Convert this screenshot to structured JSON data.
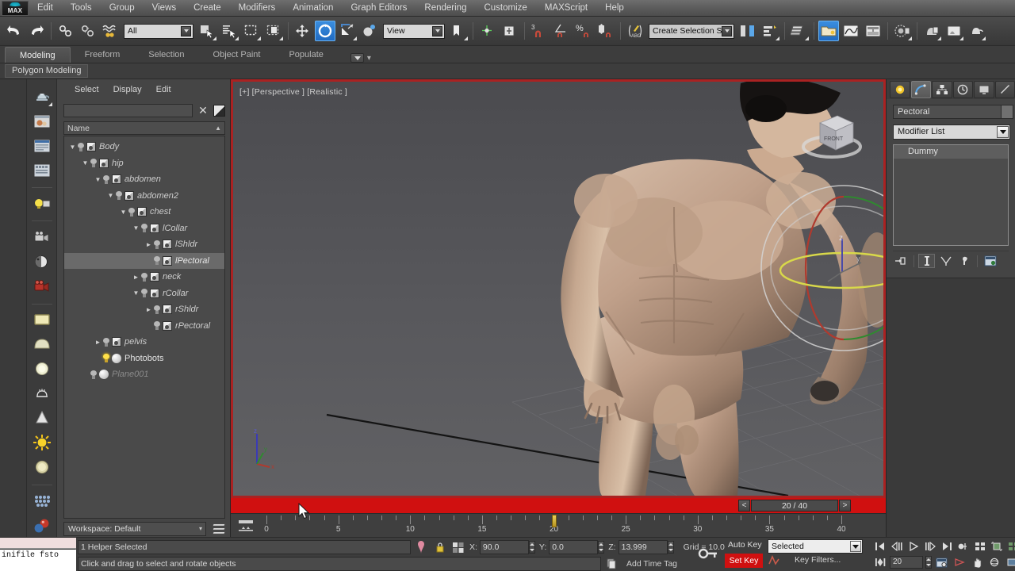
{
  "app": {
    "logo": "MAX",
    "menu": [
      "Edit",
      "Tools",
      "Group",
      "Views",
      "Create",
      "Modifiers",
      "Animation",
      "Graph Editors",
      "Rendering",
      "Customize",
      "MAXScript",
      "Help"
    ]
  },
  "toolbar": {
    "selection_filter": "All",
    "reference_coord": "View",
    "named_selection_set": "Create Selection Se",
    "snaps_percent": "%",
    "angle_snap_num": "3",
    "icons": [
      "undo-icon",
      "redo-icon",
      "select-and-link-icon",
      "unlink-selection-icon",
      "bind-to-space-warp-icon",
      "select-object-icon",
      "select-by-name-icon",
      "rectangular-selection-region-icon",
      "window-crossing-icon",
      "select-and-move-icon",
      "select-and-rotate-icon",
      "select-and-scale-icon",
      "select-and-place-icon",
      "use-pivot-point-center-icon",
      "select-and-manipulate-icon",
      "snaps-toggle-icon",
      "angle-snap-toggle-icon",
      "percent-snap-toggle-icon",
      "spinner-snap-toggle-icon",
      "edit-named-selection-sets-icon",
      "mirror-icon",
      "align-icon",
      "layer-explorer-icon",
      "scene-explorer-icon",
      "curve-editor-icon",
      "schematic-view-icon",
      "material-editor-icon",
      "render-setup-icon",
      "rendered-frame-window-icon",
      "render-production-icon"
    ]
  },
  "ribbon": {
    "tabs": [
      "Modeling",
      "Freeform",
      "Selection",
      "Object Paint",
      "Populate"
    ],
    "selected_tab": "Modeling",
    "panel_label": "Polygon Modeling"
  },
  "left_toolbox": {
    "icons": [
      "teapot-object-icon",
      "material-map-browser-icon",
      "render-frame-icon",
      "render-setup-panel-icon",
      "light-icon",
      "camera-icon",
      "shading-icon",
      "camera-red-icon",
      "box-icon",
      "sphere-icon",
      "circle-light-icon",
      "teapot-outline-icon",
      "cone-icon",
      "sun-light-icon",
      "disc-icon",
      "array-icon",
      "material-spheres-icon"
    ]
  },
  "explorer": {
    "menu": [
      "Select",
      "Display",
      "Edit"
    ],
    "search_value": "",
    "search_placeholder": "",
    "close_icon": "x-icon",
    "filter_icon": "filter-icon",
    "column_header": "Name",
    "sort_indicator": "▲",
    "tree": [
      {
        "label": "Body",
        "depth": 0,
        "twisty": "down",
        "icon": "cube",
        "state": "italic"
      },
      {
        "label": "hip",
        "depth": 1,
        "twisty": "down",
        "icon": "cube",
        "state": "italic"
      },
      {
        "label": "abdomen",
        "depth": 2,
        "twisty": "down",
        "icon": "cube",
        "state": "italic"
      },
      {
        "label": "abdomen2",
        "depth": 3,
        "twisty": "down",
        "icon": "cube",
        "state": "italic"
      },
      {
        "label": "chest",
        "depth": 4,
        "twisty": "down",
        "icon": "cube",
        "state": "italic"
      },
      {
        "label": "lCollar",
        "depth": 5,
        "twisty": "down",
        "icon": "cube",
        "state": "italic"
      },
      {
        "label": "lShldr",
        "depth": 6,
        "twisty": "right",
        "icon": "cube",
        "state": "italic"
      },
      {
        "label": "lPectoral",
        "depth": 6,
        "twisty": "none",
        "icon": "cube",
        "state": "selected"
      },
      {
        "label": "neck",
        "depth": 5,
        "twisty": "right",
        "icon": "cube",
        "state": "italic"
      },
      {
        "label": "rCollar",
        "depth": 5,
        "twisty": "down",
        "icon": "cube",
        "state": "italic"
      },
      {
        "label": "rShldr",
        "depth": 6,
        "twisty": "right",
        "icon": "cube",
        "state": "italic"
      },
      {
        "label": "rPectoral",
        "depth": 6,
        "twisty": "none",
        "icon": "cube",
        "state": "italic"
      },
      {
        "label": "pelvis",
        "depth": 2,
        "twisty": "right",
        "icon": "cube",
        "state": "italic"
      },
      {
        "label": "Photobots",
        "depth": 2,
        "twisty": "none",
        "icon": "sphere",
        "state": "plain",
        "bulb": "on"
      },
      {
        "label": "Plane001",
        "depth": 1,
        "twisty": "none",
        "icon": "sphere",
        "state": "dim"
      }
    ],
    "workspace_label": "Workspace: Default",
    "layers_icon": "layers-icon"
  },
  "viewport": {
    "label": "[+] [Perspective ] [Realistic ]",
    "nav_cube": "view-cube",
    "axis_labels": {
      "x": "x",
      "y": "y",
      "z": "z"
    },
    "gizmo_z_label": "z",
    "border_color": "#c01010",
    "background_color": "#57575b",
    "gizmo_colors": {
      "x": "#c03a30",
      "y": "#3a9a3a",
      "z": "#3b3bb5",
      "screen": "#d8d860",
      "outer": "#cccccc"
    }
  },
  "timebar": {
    "prev_label": "<",
    "frame_display": "20 / 40",
    "next_label": ">"
  },
  "ruler": {
    "labels": [
      "0",
      "5",
      "10",
      "15",
      "20",
      "25",
      "30",
      "35",
      "40"
    ],
    "min": 0,
    "max": 40,
    "playhead_frame": 20,
    "config_icon": "time-configuration-icon"
  },
  "status": {
    "mini_listener": "inifile fsto",
    "selection_text": "1 Helper Selected",
    "prompt_text": "Click and drag to select and rotate objects",
    "lock_icon": "lock-selection-icon",
    "pin_icon": "pin-stack-icon",
    "coord_icon": "absolute-relative-transform-icon",
    "x_label": "X:",
    "x_value": "90.0",
    "y_label": "Y:",
    "y_value": "0.0",
    "z_label": "Z:",
    "z_value": "13.999",
    "grid_text": "Grid = 10.0",
    "key_mode_icon": "key-mode-toggle-icon",
    "add_time_tag": "Add Time Tag",
    "auto_key_label": "Auto Key",
    "set_key_label": "Set Key",
    "key_filters_label": "Key Filters...",
    "key_selection_mode": "Selected",
    "set_key_color": "#d01010"
  },
  "playback": {
    "frame_value": "20",
    "buttons": [
      "go-to-start-icon",
      "previous-frame-icon",
      "play-animation-icon",
      "next-frame-icon",
      "go-to-end-icon",
      "key-mode-toggle-icon",
      "time-configuration-icon",
      "zoom-extents-icon",
      "maximize-viewport-icon",
      "pan-view-icon",
      "orbit-icon",
      "field-of-view-icon",
      "select-region-zoom-icon"
    ]
  },
  "command_panel": {
    "tabs": [
      "create-tab-icon",
      "modify-tab-icon",
      "hierarchy-tab-icon",
      "motion-tab-icon",
      "display-tab-icon",
      "utilities-tab-icon"
    ],
    "selected_tab_index": 1,
    "object_name": "Pectoral",
    "modifier_list_label": "Modifier List",
    "stack_entries": [
      "Dummy"
    ],
    "stack_buttons": [
      "pin-stack-icon",
      "show-end-result-icon",
      "make-unique-icon",
      "remove-modifier-icon",
      "configure-modifier-sets-icon"
    ]
  }
}
